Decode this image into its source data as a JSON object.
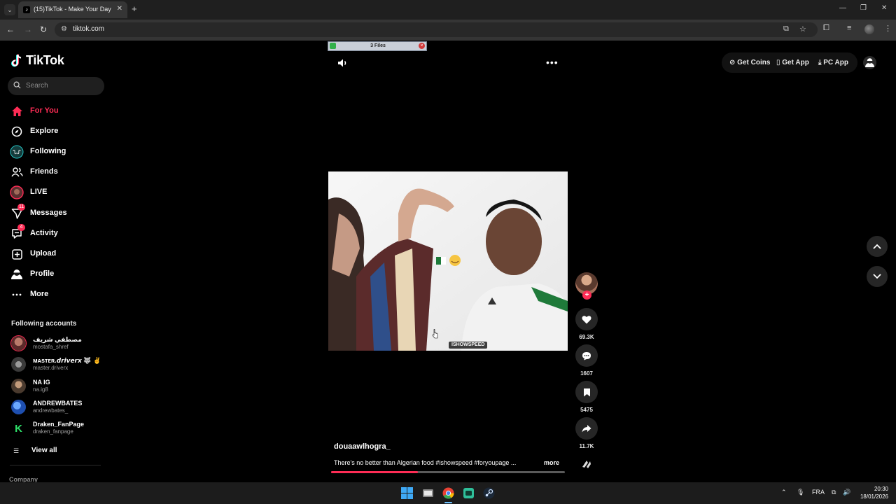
{
  "browser": {
    "tab_title": "(15)TikTok - Make Your Day",
    "url": "tiktok.com"
  },
  "sidebar": {
    "logo": "TikTok",
    "search_placeholder": "Search",
    "nav": [
      {
        "label": "For You",
        "icon": "home-icon",
        "active": true
      },
      {
        "label": "Explore",
        "icon": "compass-icon"
      },
      {
        "label": "Following",
        "icon": "following-icon"
      },
      {
        "label": "Friends",
        "icon": "friends-icon"
      },
      {
        "label": "LIVE",
        "icon": "live-icon"
      },
      {
        "label": "Messages",
        "icon": "messages-icon",
        "badge": "11"
      },
      {
        "label": "Activity",
        "icon": "activity-icon",
        "badge": "4"
      },
      {
        "label": "Upload",
        "icon": "upload-icon"
      },
      {
        "label": "Profile",
        "icon": "profile-icon"
      },
      {
        "label": "More",
        "icon": "more-dots-icon"
      }
    ],
    "following_header": "Following accounts",
    "accounts": [
      {
        "name": "مصطفي شريف",
        "handle": "mostafa_shref",
        "color": "#7a3a3a"
      },
      {
        "name": "ᴍᴀsᴛᴇʀ.𝙙𝙧𝙞𝙫𝙚𝙧𝙭 🐺 ✌️",
        "handle": "master.driverx",
        "color": "#555555"
      },
      {
        "name": "NA IG",
        "handle": "na.ig8",
        "color": "#6a5a4a"
      },
      {
        "name": "ANDREWBATES",
        "handle": "andrewbates_",
        "color": "#2f6fd6"
      },
      {
        "name": "Draken_FanPage",
        "handle": "draken_fanpage",
        "color": "#1a1a1a"
      }
    ],
    "view_all": "View all",
    "company": "Company"
  },
  "overlay": {
    "files_label": "3 Files"
  },
  "video": {
    "creator": "douaawlhogra_",
    "caption": "There's no better than Algerian food #ishowspeed #foryoupage ...",
    "more": "more",
    "watermark": "ISHOWSPEED",
    "progress": 0.37
  },
  "actions": {
    "likes": "69.3K",
    "comments": "1607",
    "saves": "5475",
    "shares": "11.7K"
  },
  "header": {
    "get_coins": "Get Coins",
    "get_app": "Get App",
    "pc_app": "PC App"
  },
  "taskbar": {
    "lang": "FRA",
    "time": "20:30",
    "date": "18/01/2026"
  },
  "colors": {
    "accent": "#fe2c55",
    "background": "#000000"
  }
}
